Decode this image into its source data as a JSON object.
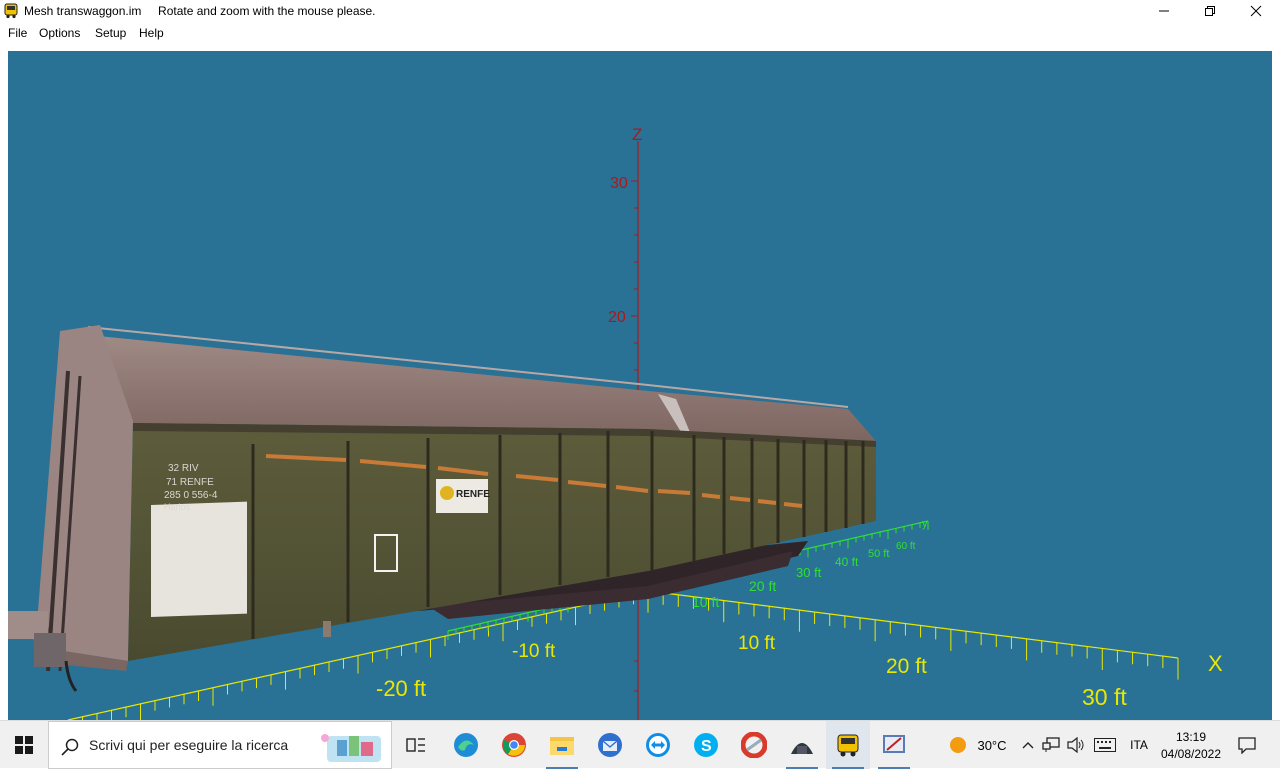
{
  "window": {
    "title": "Mesh transwaggon.im     Rotate and zoom with the mouse please."
  },
  "menu": {
    "items": [
      "File",
      "Options",
      "Setup",
      "Help"
    ]
  },
  "viewport": {
    "background": "#2a7196",
    "axis_z_label": "Z",
    "axis_x_label": "X",
    "axis_y_label": "y",
    "z_ticks": [
      "30",
      "20"
    ],
    "x_ticks": [
      "-20 ft",
      "-10 ft",
      "10 ft",
      "20 ft",
      "30 ft"
    ],
    "y_ticks": [
      "10 ft",
      "20 ft",
      "30 ft",
      "40 ft",
      "50 ft",
      "60 ft"
    ],
    "wagon_text": {
      "line1": "32 RIV",
      "line2": "71 RENFE",
      "line3": "285 0 556-4",
      "line4": "Harlos",
      "brand": "RENFE"
    },
    "colors": {
      "z_axis": "#b01818",
      "x_axis": "#e8e800",
      "y_axis": "#30e030"
    }
  },
  "taskbar": {
    "search_placeholder": "Scrivi qui per eseguire la ricerca",
    "weather": "30°C",
    "language": "ITA",
    "time": "13:19",
    "date": "04/08/2022"
  }
}
